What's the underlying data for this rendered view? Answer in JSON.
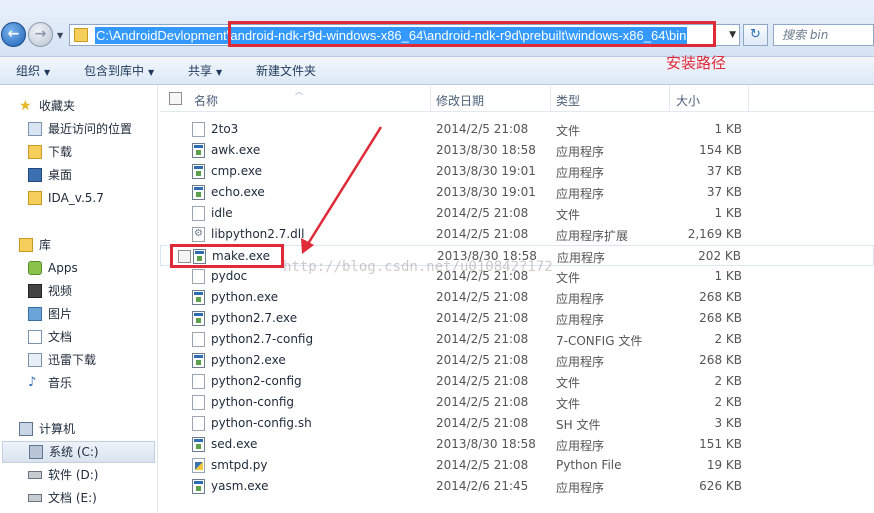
{
  "address": {
    "path_prefix": "C:\\AndroidDevlopment",
    "path_rest": "\\android-ndk-r9d-windows-x86_64\\android-ndk-r9d\\prebuilt\\windows-x86_64\\bin",
    "search_placeholder": "搜索 bin"
  },
  "annotation": "安装路径",
  "toolbar": {
    "organize": "组织",
    "include_in_library": "包含到库中",
    "share": "共享",
    "new_folder": "新建文件夹"
  },
  "sidebar": {
    "favorites": "收藏夹",
    "fav_items": [
      "最近访问的位置",
      "下载",
      "桌面",
      "IDA_v.5.7"
    ],
    "libraries": "库",
    "lib_items": [
      "Apps",
      "视频",
      "图片",
      "文档",
      "迅雷下载",
      "音乐"
    ],
    "computer": "计算机",
    "drives": [
      "系统 (C:)",
      "软件 (D:)",
      "文档 (E:)"
    ]
  },
  "columns": {
    "name": "名称",
    "modified": "修改日期",
    "type": "类型",
    "size": "大小"
  },
  "files": [
    {
      "name": "2to3",
      "date": "2014/2/5 21:08",
      "type": "文件",
      "size": "1 KB",
      "icon": "file-icon"
    },
    {
      "name": "awk.exe",
      "date": "2013/8/30 18:58",
      "type": "应用程序",
      "size": "154 KB",
      "icon": "exe-icon"
    },
    {
      "name": "cmp.exe",
      "date": "2013/8/30 19:01",
      "type": "应用程序",
      "size": "37 KB",
      "icon": "exe-icon"
    },
    {
      "name": "echo.exe",
      "date": "2013/8/30 19:01",
      "type": "应用程序",
      "size": "37 KB",
      "icon": "exe-icon"
    },
    {
      "name": "idle",
      "date": "2014/2/5 21:08",
      "type": "文件",
      "size": "1 KB",
      "icon": "file-icon"
    },
    {
      "name": "libpython2.7.dll",
      "date": "2014/2/5 21:08",
      "type": "应用程序扩展",
      "size": "2,169 KB",
      "icon": "dll-icon"
    },
    {
      "name": "make.exe",
      "date": "2013/8/30 18:58",
      "type": "应用程序",
      "size": "202 KB",
      "icon": "exe-icon"
    },
    {
      "name": "pydoc",
      "date": "2014/2/5 21:08",
      "type": "文件",
      "size": "1 KB",
      "icon": "file-icon"
    },
    {
      "name": "python.exe",
      "date": "2014/2/5 21:08",
      "type": "应用程序",
      "size": "268 KB",
      "icon": "exe-icon"
    },
    {
      "name": "python2.7.exe",
      "date": "2014/2/5 21:08",
      "type": "应用程序",
      "size": "268 KB",
      "icon": "exe-icon"
    },
    {
      "name": "python2.7-config",
      "date": "2014/2/5 21:08",
      "type": "7-CONFIG 文件",
      "size": "2 KB",
      "icon": "file-icon"
    },
    {
      "name": "python2.exe",
      "date": "2014/2/5 21:08",
      "type": "应用程序",
      "size": "268 KB",
      "icon": "exe-icon"
    },
    {
      "name": "python2-config",
      "date": "2014/2/5 21:08",
      "type": "文件",
      "size": "2 KB",
      "icon": "file-icon"
    },
    {
      "name": "python-config",
      "date": "2014/2/5 21:08",
      "type": "文件",
      "size": "2 KB",
      "icon": "file-icon"
    },
    {
      "name": "python-config.sh",
      "date": "2014/2/5 21:08",
      "type": "SH 文件",
      "size": "3 KB",
      "icon": "file-icon"
    },
    {
      "name": "sed.exe",
      "date": "2013/8/30 18:58",
      "type": "应用程序",
      "size": "151 KB",
      "icon": "exe-icon"
    },
    {
      "name": "smtpd.py",
      "date": "2014/2/5 21:08",
      "type": "Python File",
      "size": "19 KB",
      "icon": "python-file-icon"
    },
    {
      "name": "yasm.exe",
      "date": "2014/2/6 21:45",
      "type": "应用程序",
      "size": "626 KB",
      "icon": "exe-icon"
    }
  ],
  "watermark": "http://blog.csdn.net/u010842?172",
  "colors": {
    "annotation_red": "#e02a38",
    "selection_blue": "#3399ff"
  }
}
